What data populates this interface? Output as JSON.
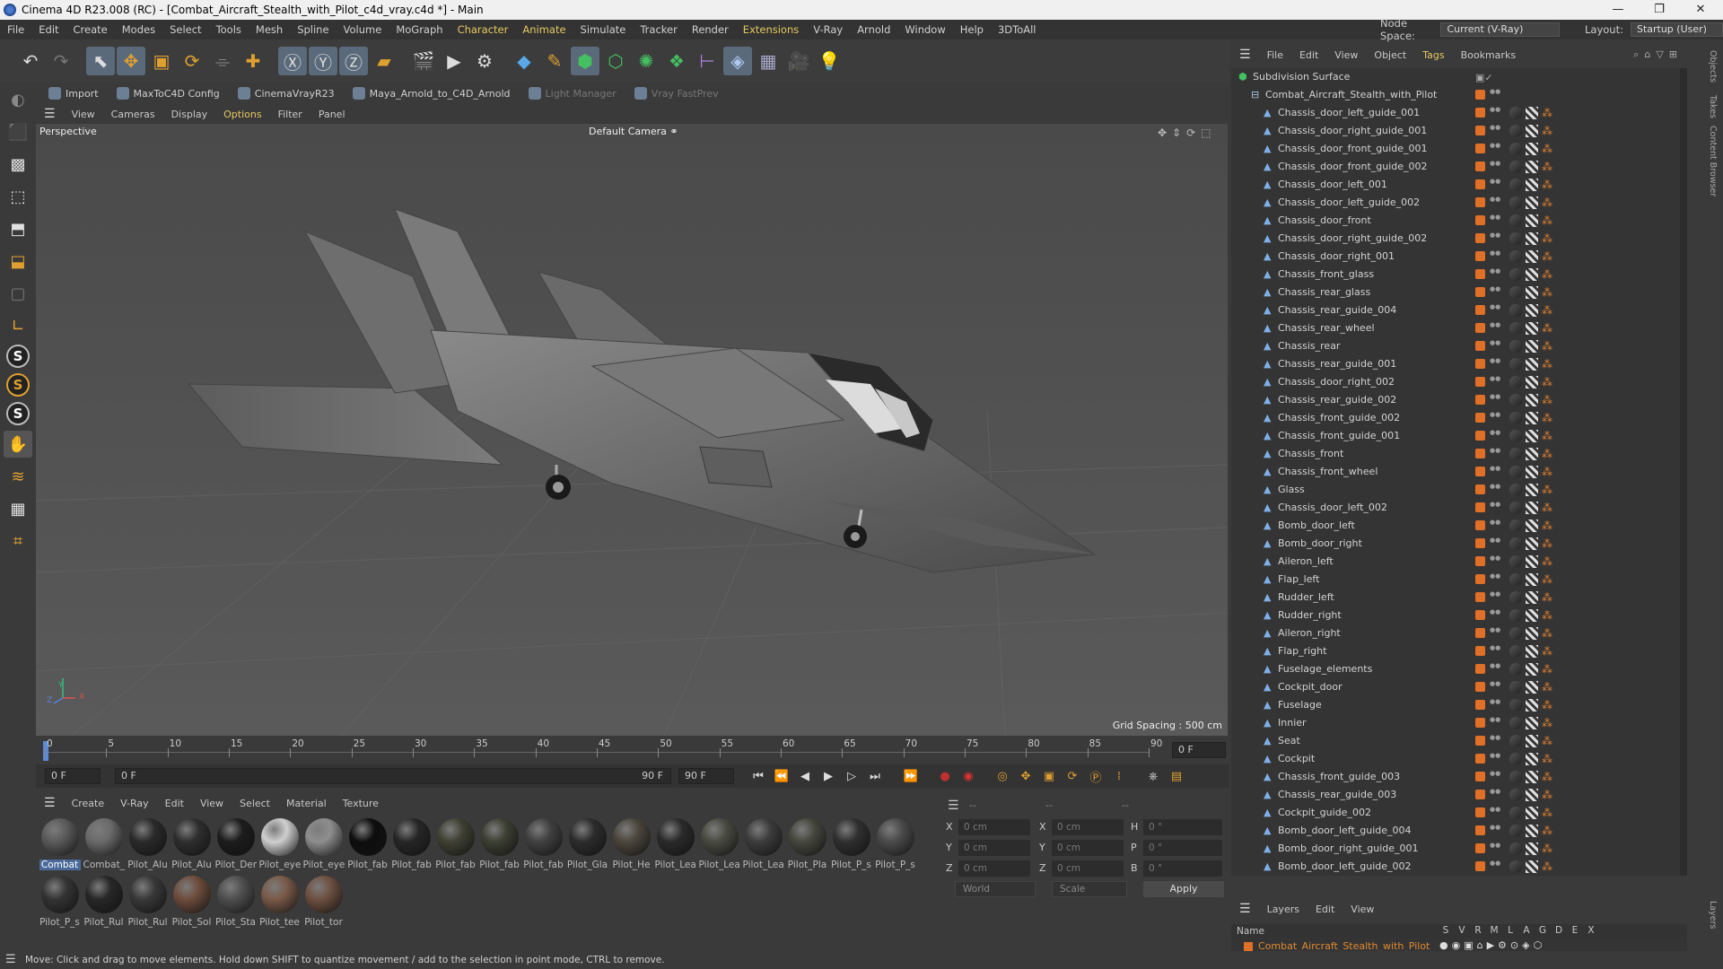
{
  "window": {
    "title": "Cinema 4D R23.008 (RC) - [Combat_Aircraft_Stealth_with_Pilot_c4d_vray.c4d *] - Main",
    "min": "—",
    "max": "❐",
    "close": "✕"
  },
  "menu": [
    "File",
    "Edit",
    "Create",
    "Modes",
    "Select",
    "Tools",
    "Mesh",
    "Spline",
    "Volume",
    "MoGraph",
    "Character",
    "Animate",
    "Simulate",
    "Tracker",
    "Render",
    "Extensions",
    "V-Ray",
    "Arnold",
    "Window",
    "Help",
    "3DToAll"
  ],
  "node_space": {
    "label": "Node Space:",
    "value": "Current (V-Ray)"
  },
  "layout": {
    "label": "Layout:",
    "value": "Startup (User)"
  },
  "plugins": [
    {
      "label": "Import",
      "enabled": true
    },
    {
      "label": "MaxToC4D Config",
      "enabled": true
    },
    {
      "label": "CinemaVrayR23",
      "enabled": true
    },
    {
      "label": "Maya_Arnold_to_C4D_Arnold",
      "enabled": true
    },
    {
      "label": "Light Manager",
      "enabled": false
    },
    {
      "label": "Vray FastPrev",
      "enabled": false
    }
  ],
  "viewport": {
    "menu": [
      "View",
      "Cameras",
      "Display",
      "Options",
      "Filter",
      "Panel"
    ],
    "name": "Perspective",
    "camera": "Default Camera",
    "grid_spacing": "Grid Spacing : 500 cm",
    "axis_labels": {
      "y": "Y",
      "z": "Z",
      "x": "X"
    }
  },
  "timeline": {
    "ticks": [
      "0",
      "5",
      "10",
      "15",
      "20",
      "25",
      "30",
      "35",
      "40",
      "45",
      "50",
      "55",
      "60",
      "65",
      "70",
      "75",
      "80",
      "85",
      "90"
    ],
    "current_frame": "0 F",
    "start": "0 F",
    "range_start": "0 F",
    "range_end": "90 F",
    "end": "90 F",
    "end_field": "90 F"
  },
  "materials": {
    "menu": [
      "Create",
      "V-Ray",
      "Edit",
      "View",
      "Select",
      "Material",
      "Texture"
    ],
    "items": [
      {
        "label": "Combat",
        "color": "#5a5a5a"
      },
      {
        "label": "Combat_",
        "color": "#6a6a6a"
      },
      {
        "label": "Pilot_Alu",
        "color": "#2a2a2a"
      },
      {
        "label": "Pilot_Alu",
        "color": "#2e2e2e"
      },
      {
        "label": "Pilot_Der",
        "color": "#1c1c1c"
      },
      {
        "label": "Pilot_eye",
        "color": "#cfcfcf"
      },
      {
        "label": "Pilot_eye",
        "color": "#8e8e8e"
      },
      {
        "label": "Pilot_fab",
        "color": "#0e0e0e"
      },
      {
        "label": "Pilot_fab",
        "color": "#262626"
      },
      {
        "label": "Pilot_fab",
        "color": "#3f4032"
      },
      {
        "label": "Pilot_fab",
        "color": "#3c3f32"
      },
      {
        "label": "Pilot_fab",
        "color": "#404040"
      },
      {
        "label": "Pilot_Gla",
        "color": "#2c2c2c"
      },
      {
        "label": "Pilot_He",
        "color": "#4b463c"
      },
      {
        "label": "Pilot_Lea",
        "color": "#2a2a2a"
      },
      {
        "label": "Pilot_Lea",
        "color": "#484a40"
      },
      {
        "label": "Pilot_Lea",
        "color": "#3c3c3c"
      },
      {
        "label": "Pilot_Pla",
        "color": "#45473c"
      },
      {
        "label": "Pilot_P_s",
        "color": "#2f2f2f"
      },
      {
        "label": "Pilot_P_s",
        "color": "#4a4a4a"
      },
      {
        "label": "Pilot_P_s",
        "color": "#333333"
      },
      {
        "label": "Pilot_Rul",
        "color": "#272727"
      },
      {
        "label": "Pilot_Rul",
        "color": "#383838"
      },
      {
        "label": "Pilot_Sol",
        "color": "#6e4c3c"
      },
      {
        "label": "Pilot_Sta",
        "color": "#4e4e4e"
      },
      {
        "label": "Pilot_tee",
        "color": "#7a5a48"
      },
      {
        "label": "Pilot_tor",
        "color": "#6e5040"
      }
    ]
  },
  "coords": {
    "menu_dash": "--",
    "labels": {
      "x": "X",
      "y": "Y",
      "z": "Z",
      "h": "H",
      "p": "P",
      "b": "B"
    },
    "pos": {
      "x": "0 cm",
      "y": "0 cm",
      "z": "0 cm"
    },
    "size": {
      "x": "0 cm",
      "y": "0 cm",
      "z": "0 cm"
    },
    "rot": {
      "h": "0 °",
      "p": "0 °",
      "b": "0 °"
    },
    "space": "World",
    "mode": "Scale",
    "apply": "Apply"
  },
  "objects": {
    "menu": [
      "File",
      "Edit",
      "View",
      "Object",
      "Tags",
      "Bookmarks"
    ],
    "root": "Subdivision Surface",
    "group": "Combat_Aircraft_Stealth_with_Pilot",
    "items": [
      "Chassis_door_left_guide_001",
      "Chassis_door_right_guide_001",
      "Chassis_door_front_guide_001",
      "Chassis_door_front_guide_002",
      "Chassis_door_left_001",
      "Chassis_door_left_guide_002",
      "Chassis_door_front",
      "Chassis_door_right_guide_002",
      "Chassis_door_right_001",
      "Chassis_front_glass",
      "Chassis_rear_glass",
      "Chassis_rear_guide_004",
      "Chassis_rear_wheel",
      "Chassis_rear",
      "Chassis_rear_guide_001",
      "Chassis_door_right_002",
      "Chassis_rear_guide_002",
      "Chassis_front_guide_002",
      "Chassis_front_guide_001",
      "Chassis_front",
      "Chassis_front_wheel",
      "Glass",
      "Chassis_door_left_002",
      "Bomb_door_left",
      "Bomb_door_right",
      "Aileron_left",
      "Flap_left",
      "Rudder_left",
      "Rudder_right",
      "Aileron_right",
      "Flap_right",
      "Fuselage_elements",
      "Cockpit_door",
      "Fuselage",
      "Innier",
      "Seat",
      "Cockpit",
      "Chassis_front_guide_003",
      "Chassis_rear_guide_003",
      "Cockpit_guide_002",
      "Bomb_door_left_guide_004",
      "Bomb_door_right_guide_001",
      "Bomb_door_left_guide_002"
    ]
  },
  "side_tabs": [
    "Objects",
    "Takes",
    "Content Browser",
    "Layers"
  ],
  "layers": {
    "menu": [
      "Layers",
      "Edit",
      "View"
    ],
    "name_header": "Name",
    "columns": [
      "S",
      "V",
      "R",
      "M",
      "L",
      "A",
      "G",
      "D",
      "E",
      "X"
    ],
    "row": "Combat_Aircraft_Stealth_with_Pilot"
  },
  "status": "Move: Click and drag to move elements. Hold down SHIFT to quantize movement / add to the selection in point mode, CTRL to remove."
}
